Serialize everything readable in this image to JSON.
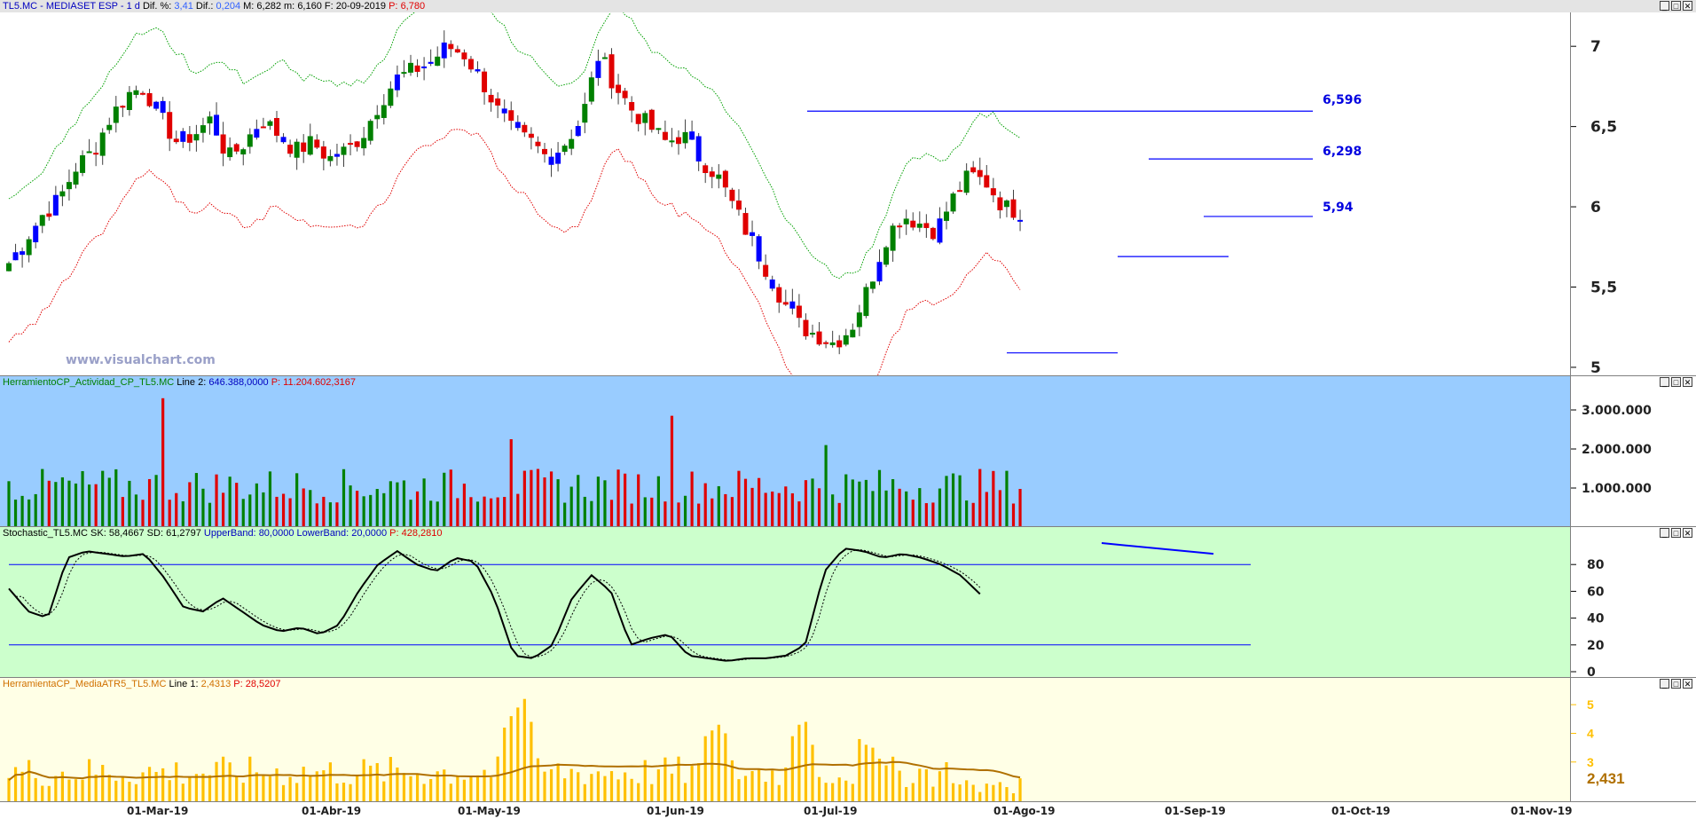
{
  "window": {
    "symbol": "TL5.MC - MEDIASET ESP",
    "period": "1 d",
    "dif_pct_label": "Dif. %:",
    "dif_pct": "3,41",
    "dif_label": "Dif.:",
    "dif": "0,204",
    "max_label": "M:",
    "max": "6,282",
    "min_label": "m:",
    "min": "6,160",
    "date_label": "F:",
    "date": "20-09-2019",
    "price_label": "P:",
    "price": "6,780",
    "btn_min": "_",
    "btn_max": "□",
    "btn_close": "✕"
  },
  "watermark": "www.visualchart.com",
  "colors": {
    "up": "#008000",
    "down": "#e00000",
    "blue_candle": "#0000ff",
    "line": "#0000ff",
    "upper_band": "#00a000",
    "lower_band": "#e00000",
    "vol_up": "#008000",
    "vol_down": "#e00000",
    "atr_bar": "#ffc000",
    "atr_line": "#b07000"
  },
  "panels": {
    "activity": {
      "name": "HerramientoCP_Actividad_CP_TL5.MC",
      "line_label": "Line 2:",
      "line_value": "646.388,0000",
      "p_label": "P:",
      "p_value": "11.204.602,3167"
    },
    "stochastic": {
      "name": "Stochastic_TL5.MC",
      "sk_label": "SK:",
      "sk": "58,4667",
      "sd_label": "SD:",
      "sd": "61,2797",
      "ub_label": "UpperBand:",
      "ub": "80,0000",
      "lb_label": "LowerBand:",
      "lb": "20,0000",
      "p_label": "P:",
      "p_value": "428,2810"
    },
    "atr": {
      "name": "HerramientaCP_MediaATR5_TL5.MC",
      "line_label": "Line 1:",
      "line_value": "2,4313",
      "p_label": "P:",
      "p_value": "28,5207",
      "last_value": "2,431"
    }
  },
  "chart_data": [
    {
      "type": "candlestick",
      "title": "TL5.MC - MEDIASET ESP - 1 d",
      "x_ticks": [
        "01-Mar-19",
        "01-Abr-19",
        "01-May-19",
        "01-Jun-19",
        "01-Jul-19",
        "01-Ago-19",
        "01-Sep-19",
        "01-Oct-19",
        "01-Nov-19"
      ],
      "y_ticks": [
        "7",
        "6,5",
        "6",
        "5,5",
        "5"
      ],
      "ylim": [
        4.95,
        7.2
      ],
      "close_path": [
        5.65,
        5.8,
        5.95,
        6.05,
        6.25,
        6.35,
        6.55,
        6.7,
        6.75,
        6.55,
        6.4,
        6.45,
        6.55,
        6.3,
        6.4,
        6.55,
        6.45,
        6.35,
        6.4,
        6.3,
        6.35,
        6.45,
        6.65,
        6.8,
        6.85,
        6.9,
        7.0,
        6.95,
        6.8,
        6.6,
        6.45,
        6.4,
        6.3,
        6.4,
        6.55,
        6.95,
        6.75,
        6.6,
        6.5,
        6.4,
        6.45,
        6.3,
        6.2,
        6.0,
        5.8,
        5.6,
        5.4,
        5.25,
        5.2,
        5.15,
        5.25,
        5.5,
        5.8,
        5.95,
        5.9,
        5.85,
        6.05,
        6.2,
        6.15,
        6.0,
        5.97
      ],
      "horizontal_levels": [
        {
          "label": "6,596",
          "value": 6.596
        },
        {
          "label": "6,298",
          "value": 6.298
        },
        {
          "label": "5,94",
          "value": 5.94
        }
      ],
      "support_lines": [
        5.69,
        5.09
      ]
    },
    {
      "type": "bar",
      "title": "HerramientoCP_Actividad_CP_TL5.MC",
      "y_ticks": [
        "3.000.000",
        "2.000.000",
        "1.000.000"
      ],
      "ylim": [
        0,
        3500000
      ],
      "spikes": [
        {
          "x": "Mar-19",
          "value": 3300000
        },
        {
          "x": "Jun-19",
          "value": 2250000
        },
        {
          "x": "Jul-19",
          "value": 2850000
        },
        {
          "x": "Ago-19",
          "value": 2100000
        }
      ]
    },
    {
      "type": "line",
      "title": "Stochastic_TL5.MC",
      "y_ticks": [
        "80",
        "60",
        "40",
        "20",
        "0"
      ],
      "ylim": [
        0,
        100
      ],
      "bands": [
        80,
        20
      ],
      "sk_path": [
        62,
        45,
        40,
        85,
        90,
        88,
        86,
        88,
        70,
        48,
        45,
        55,
        45,
        35,
        30,
        33,
        28,
        35,
        60,
        80,
        90,
        80,
        75,
        85,
        82,
        55,
        12,
        10,
        20,
        55,
        72,
        60,
        20,
        25,
        28,
        12,
        10,
        8,
        10,
        10,
        12,
        20,
        75,
        92,
        90,
        85,
        88,
        85,
        80,
        72,
        58
      ]
    },
    {
      "type": "bar",
      "title": "HerramientaCP_MediaATR5_TL5.MC",
      "y_ticks": [
        "5",
        "4",
        "3"
      ],
      "ylim": [
        1.6,
        5.5
      ],
      "last_value": 2.431
    }
  ]
}
